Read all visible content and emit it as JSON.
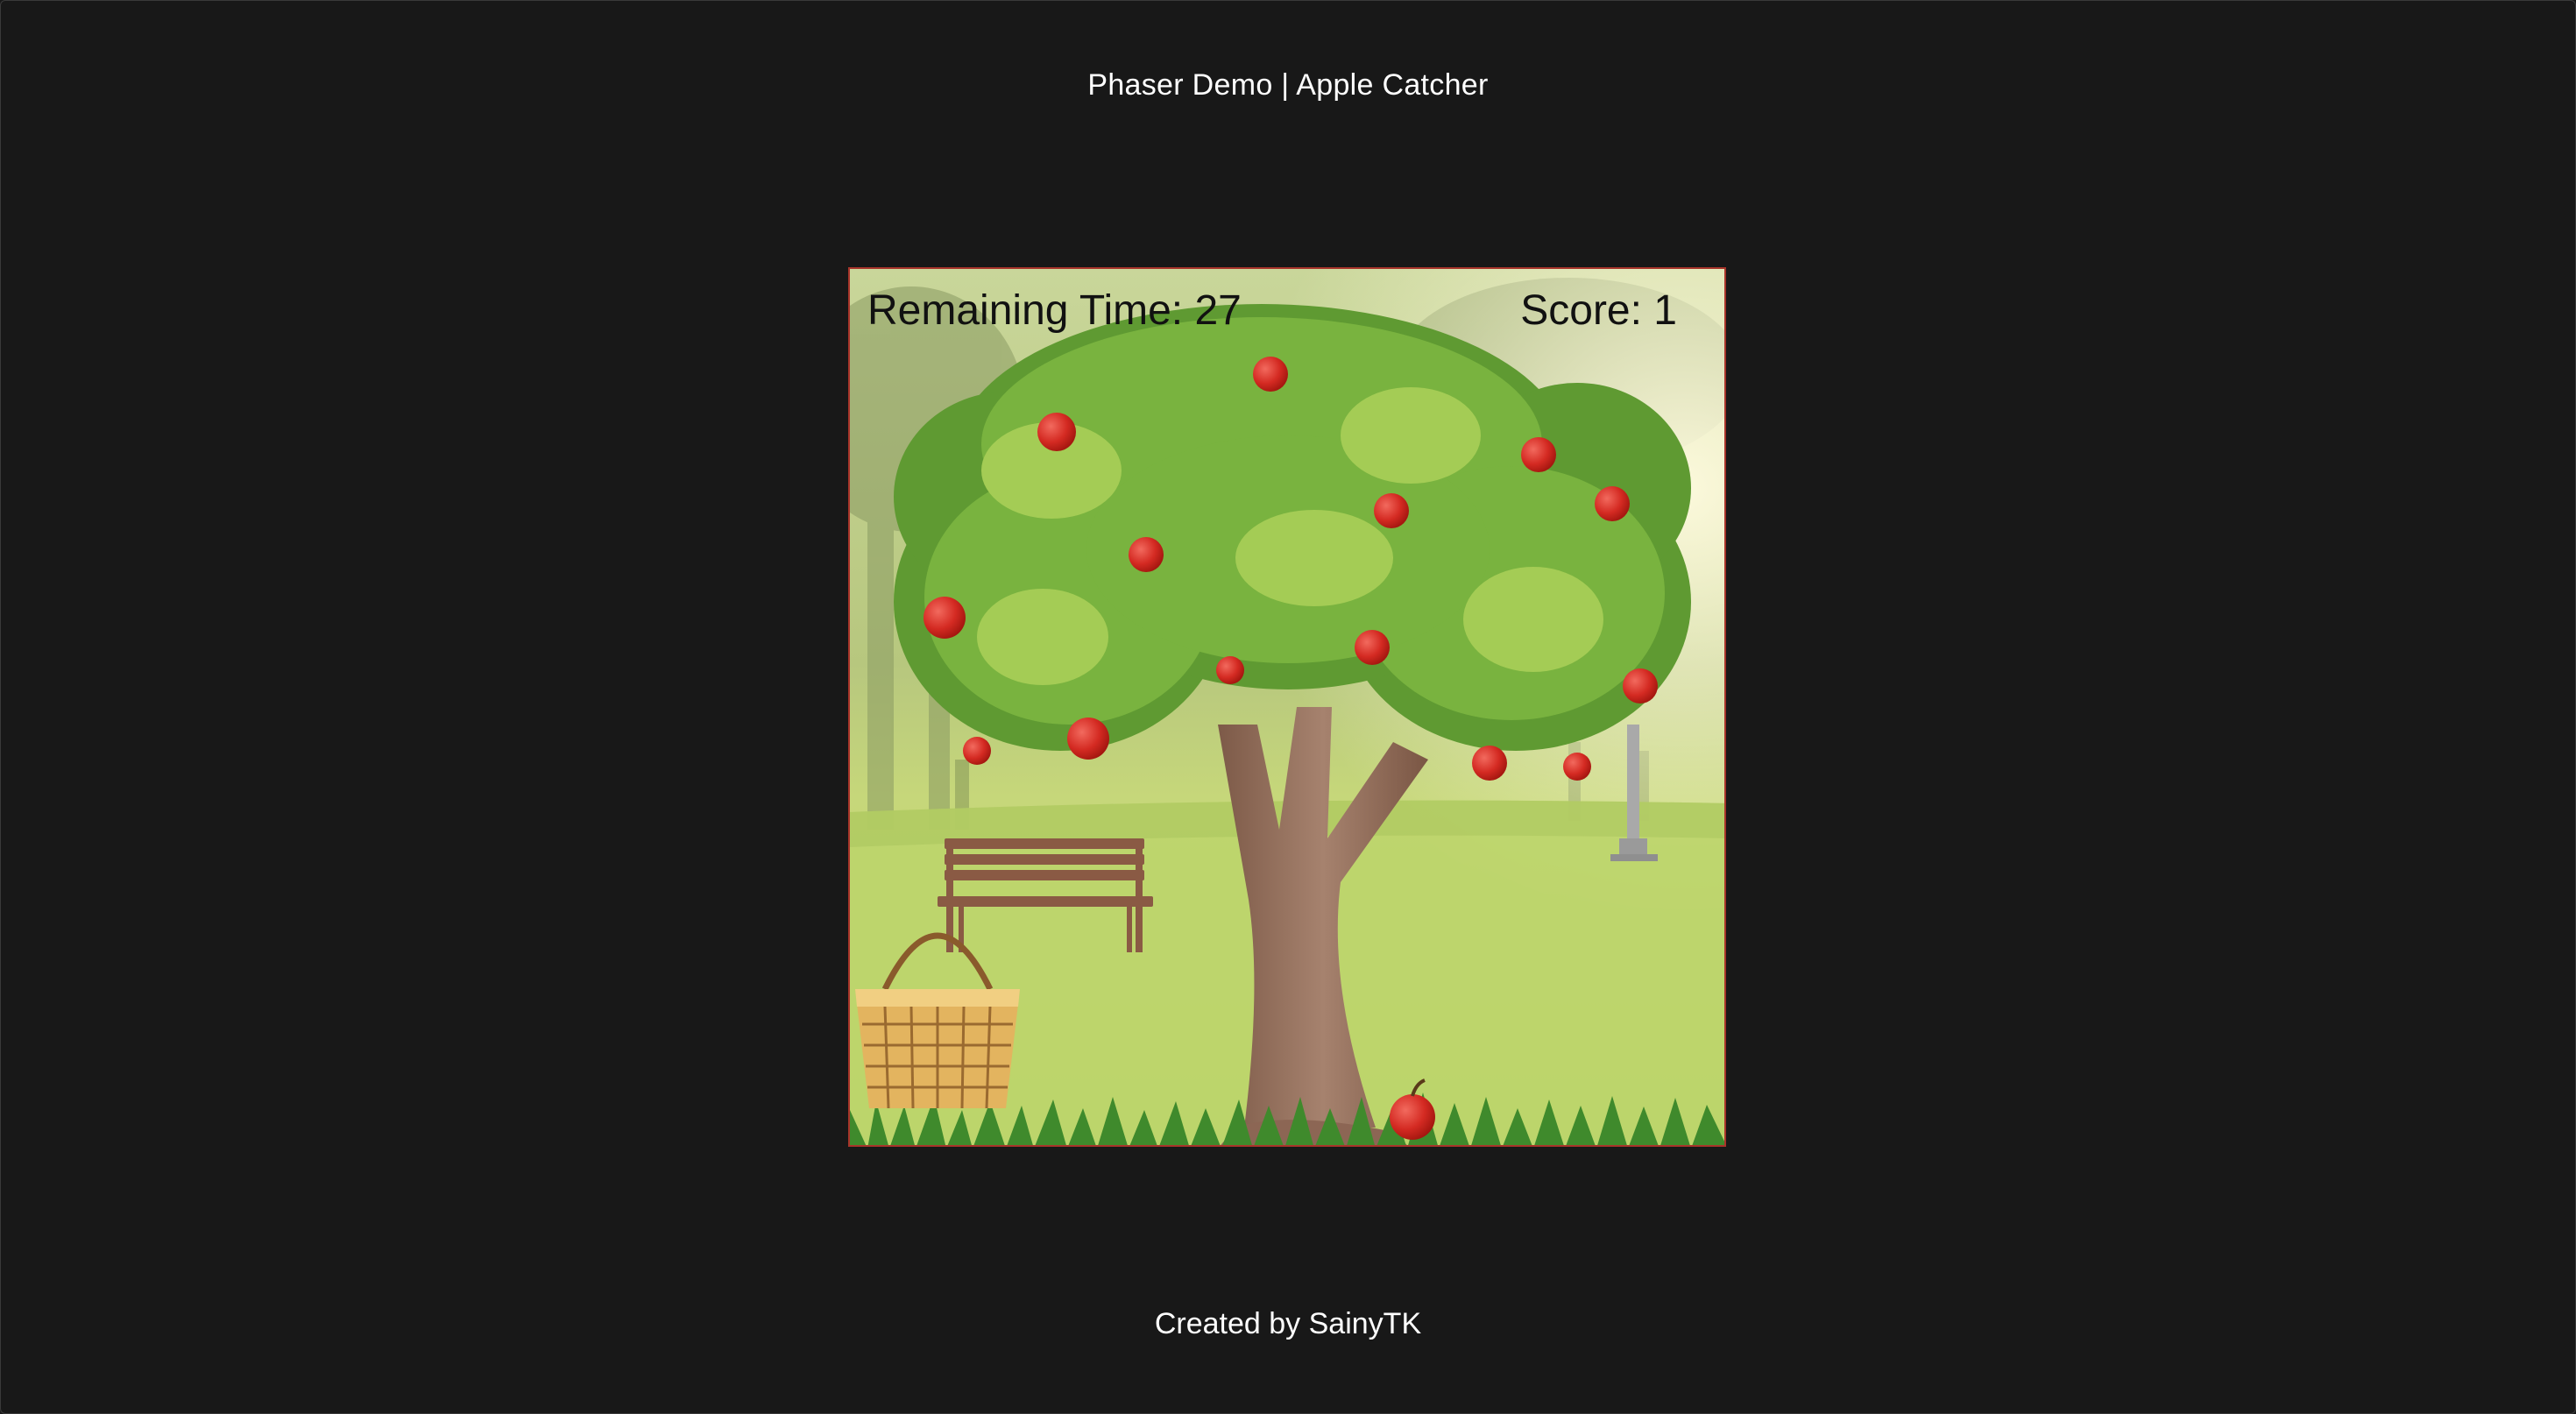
{
  "page": {
    "title": "Phaser Demo | Apple Catcher",
    "footer": "Created by SainyTK"
  },
  "game": {
    "time_label": "Remaining Time: 27",
    "score_label": "Score: 1",
    "remaining_time": 27,
    "score": 1,
    "border_color": "#a8342a"
  },
  "icons": [
    "apple-icon",
    "basket-icon",
    "bench-icon",
    "lamp-post-icon",
    "tree-icon"
  ]
}
